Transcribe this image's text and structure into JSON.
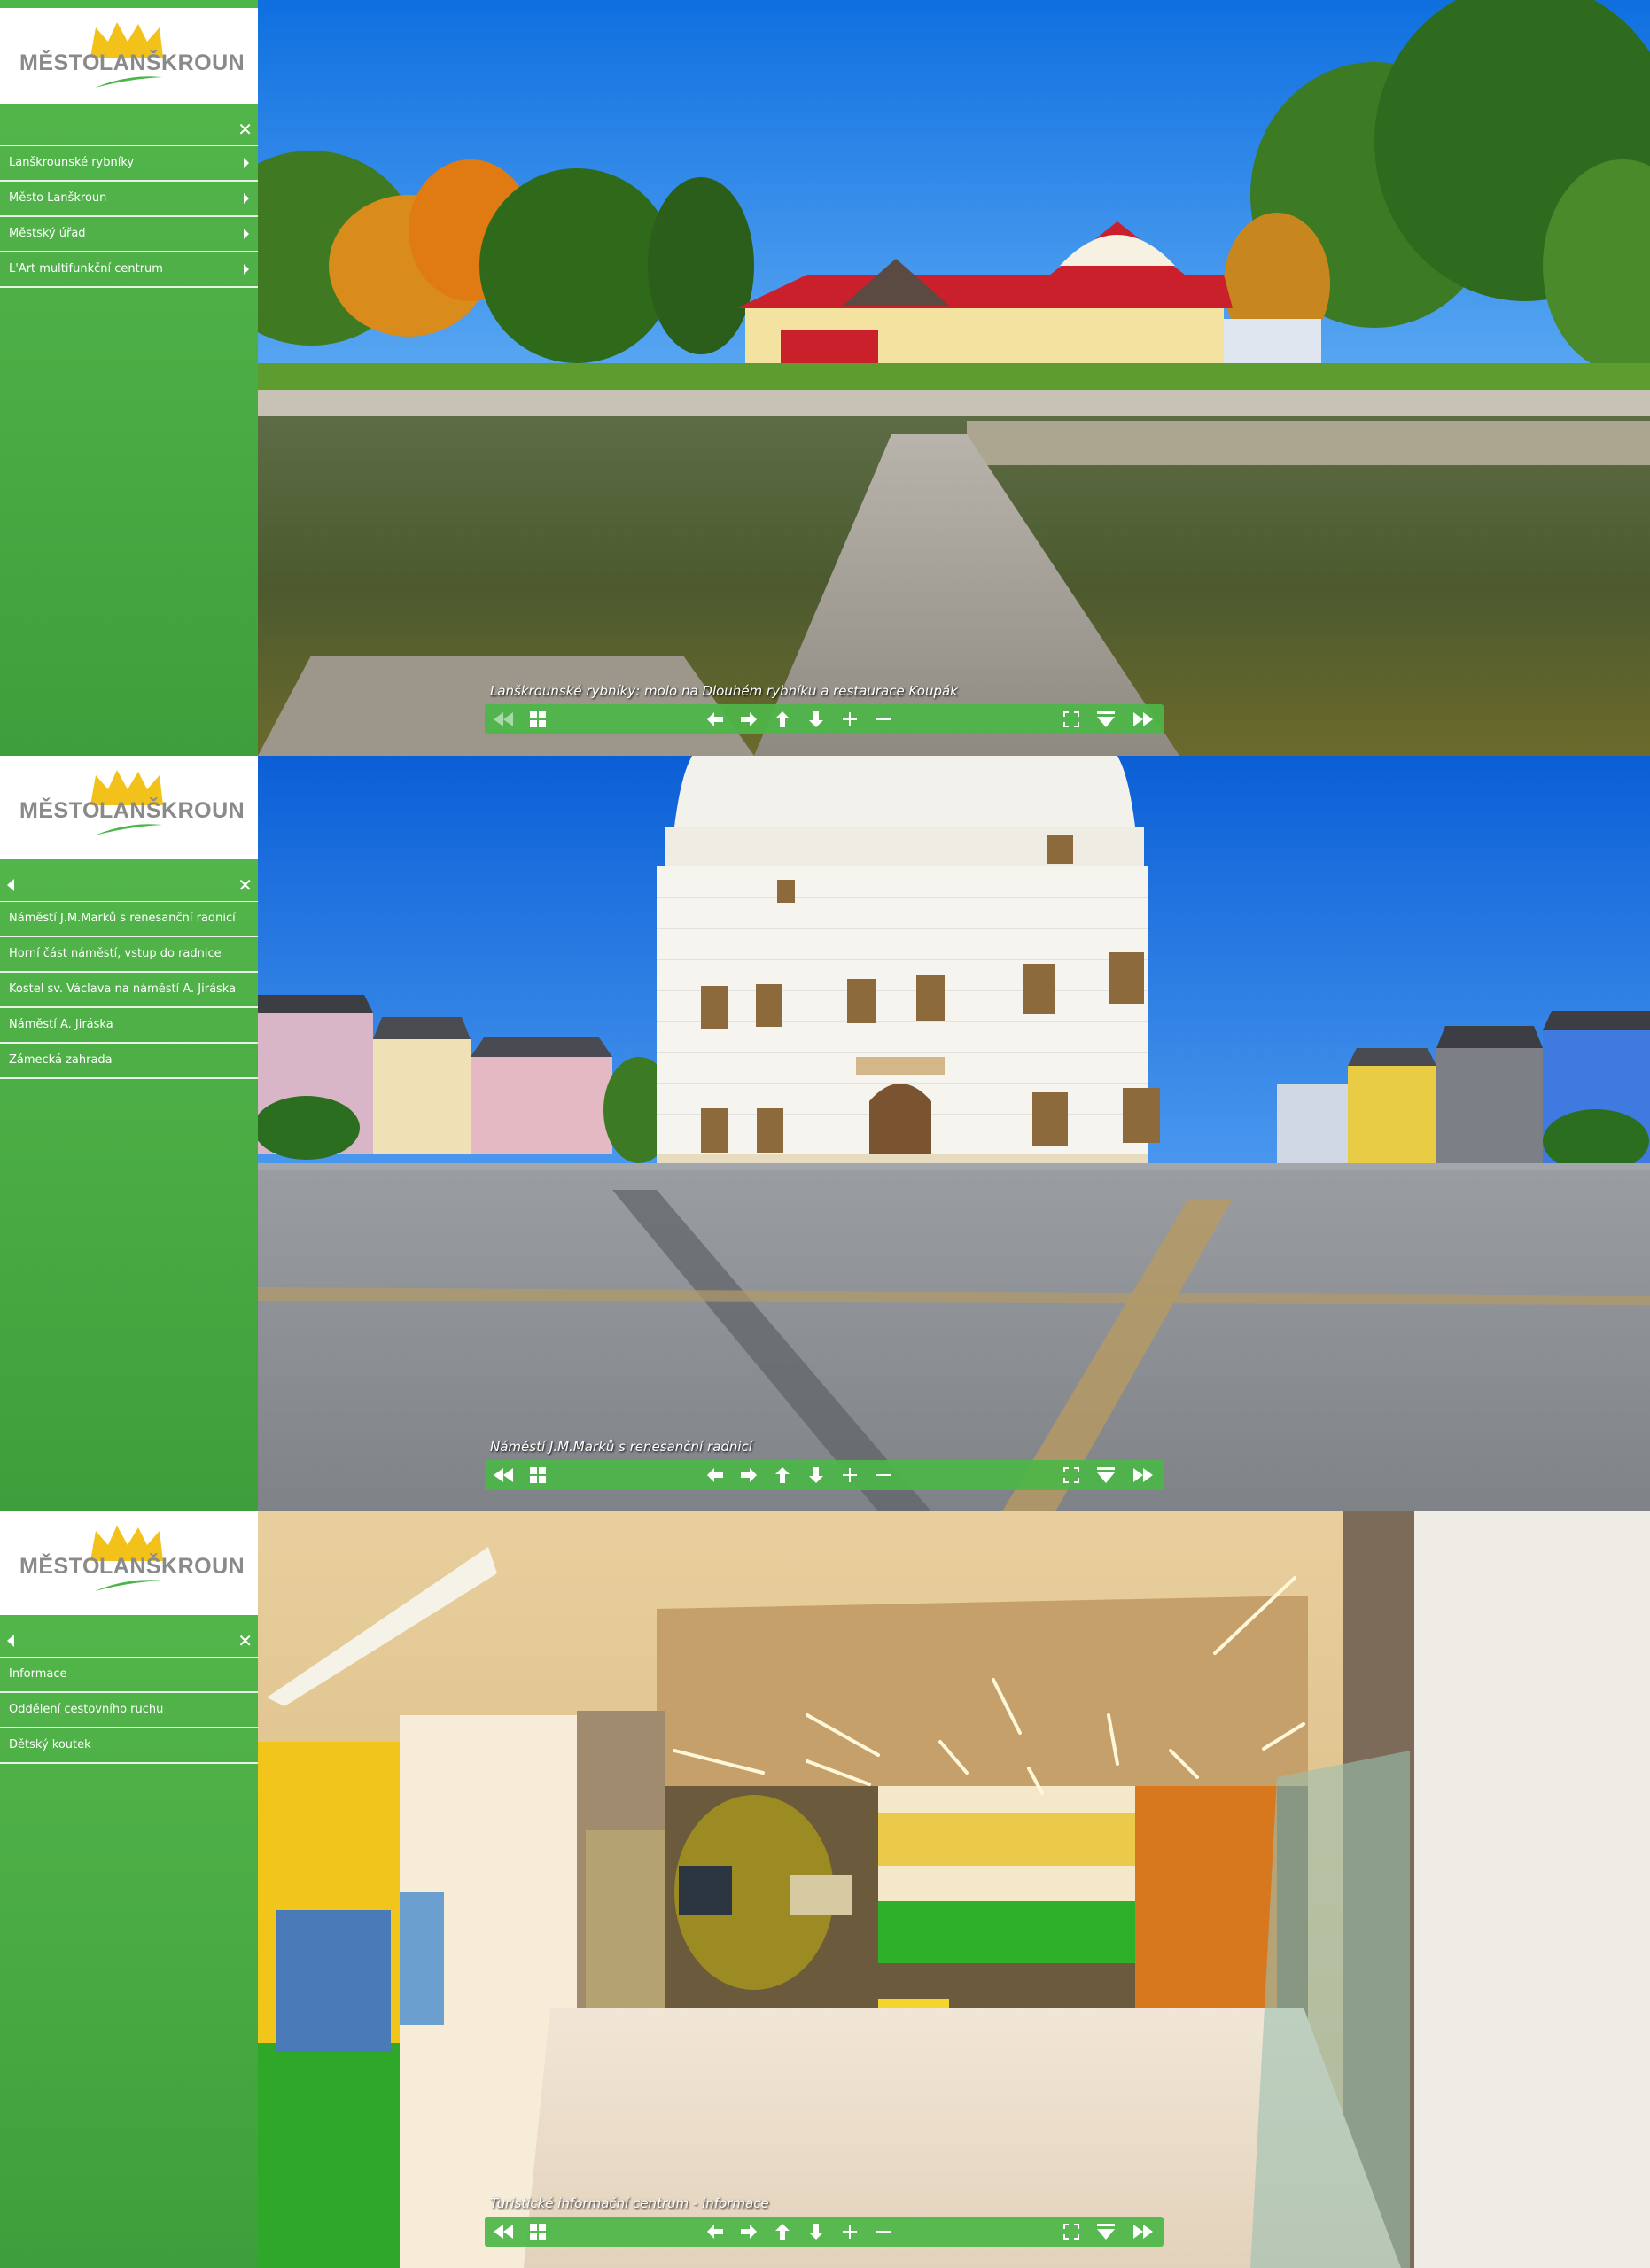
{
  "logo": {
    "mesto": "MĚSTO",
    "lanskroun": "LANŠKROUN"
  },
  "panels": [
    {
      "menu_items": [
        {
          "label": "Lanškrounské rybníky"
        },
        {
          "label": "Město Lanškroun"
        },
        {
          "label": "Městský úřad"
        },
        {
          "label": "L'Art multifunkční centrum"
        }
      ],
      "caption": "Lanškrounské rybníky: molo na Dlouhém rybníku a restaurace Koupák"
    },
    {
      "menu_items": [
        {
          "label": "Náměstí J.M.Marků s renesanční radnicí"
        },
        {
          "label": "Horní část náměstí, vstup do radnice"
        },
        {
          "label": "Kostel sv. Václava na náměstí A. Jiráska"
        },
        {
          "label": "Náměstí A. Jiráska"
        },
        {
          "label": "Zámecká zahrada"
        }
      ],
      "caption": "Náměstí J.M.Marků s renesanční radnicí"
    },
    {
      "menu_items": [
        {
          "label": "Informace"
        },
        {
          "label": "Oddělení cestovního ruchu"
        },
        {
          "label": "Dětský koutek"
        }
      ],
      "caption": "Turistické informační centrum - informace"
    }
  ],
  "icons": {
    "close": "close-icon",
    "back": "back-icon",
    "toolbar": [
      "rewind-icon",
      "grid-icon",
      "arrow-left-icon",
      "arrow-right-icon",
      "arrow-up-icon",
      "arrow-down-icon",
      "zoom-in-icon",
      "zoom-out-icon",
      "fullscreen-icon",
      "hide-toolbar-icon",
      "fast-forward-icon"
    ]
  },
  "colors": {
    "brand_green": "#4cb648",
    "logo_gray": "#8a8a8a",
    "crown_yellow": "#f2c21b",
    "sky_blue": "#1e7de6"
  }
}
